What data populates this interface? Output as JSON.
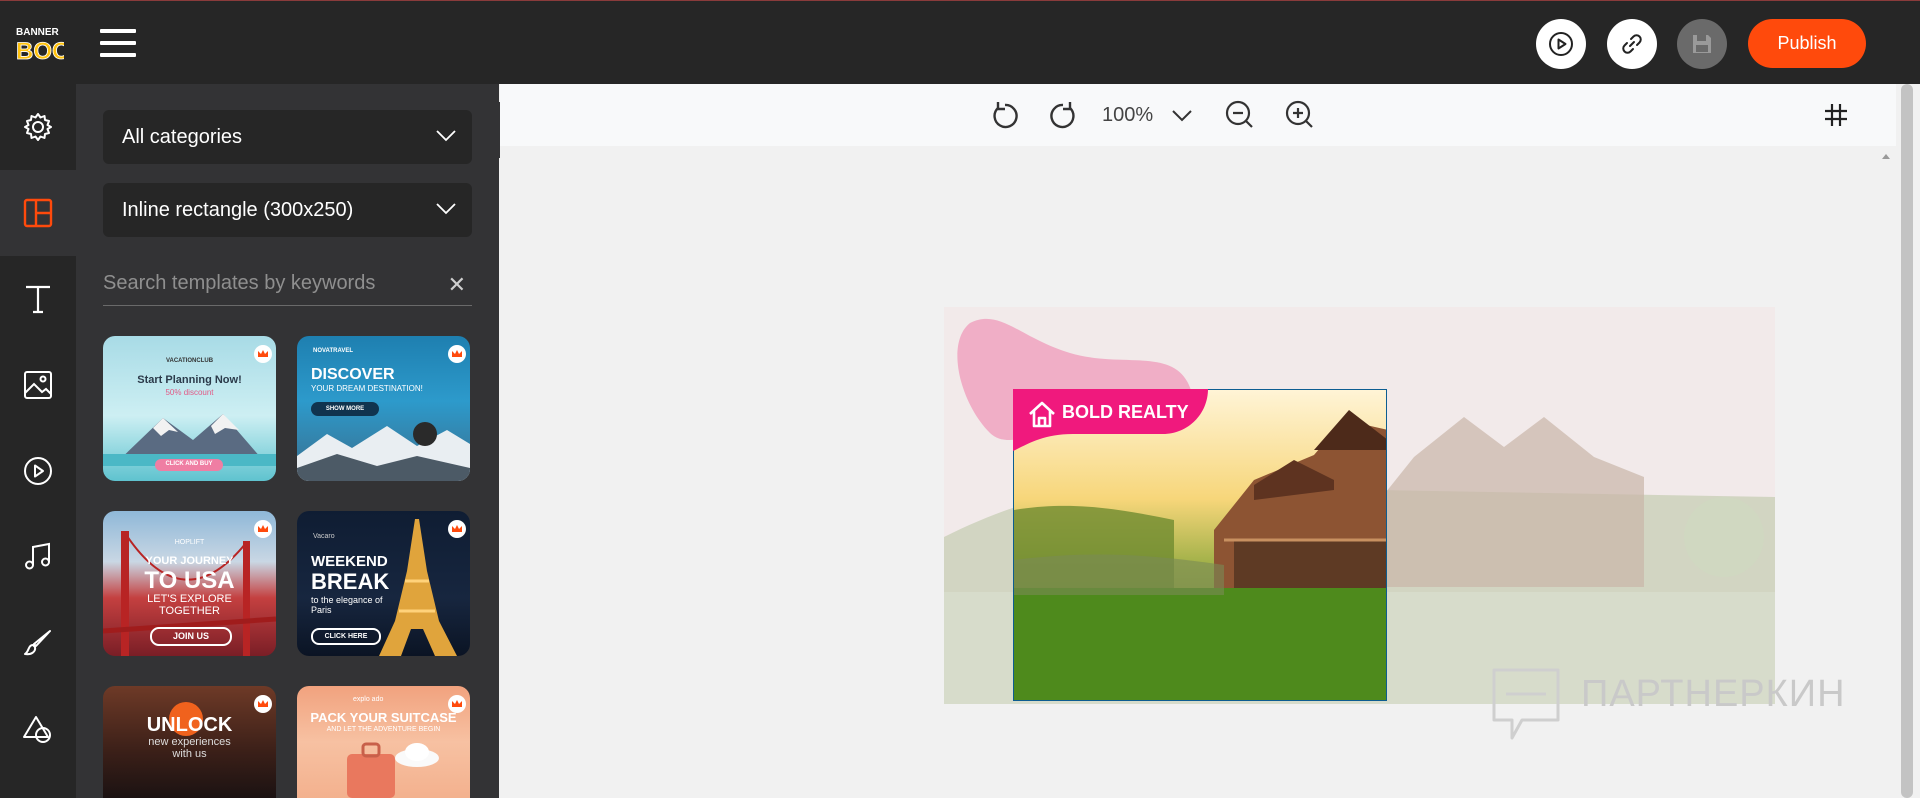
{
  "app": {
    "logo_line1": "BANNER",
    "logo_line2": "BOO"
  },
  "topbar": {
    "publish_label": "Publish"
  },
  "panel": {
    "category_value": "All categories",
    "size_value": "Inline rectangle (300x250)",
    "search_placeholder": "Search templates by keywords"
  },
  "templates": [
    {
      "brand": "VACATIONCLUB",
      "title": "Start Planning Now!",
      "subtitle": "50% discount",
      "cta": "CLICK AND BUY"
    },
    {
      "brand": "NOVATRAVEL",
      "title": "DISCOVER",
      "subtitle": "YOUR DREAM DESTINATION!",
      "cta": "SHOW MORE"
    },
    {
      "brand": "HOPLIFT",
      "title_small": "YOUR JOURNEY",
      "title": "TO USA",
      "subtitle": "LET'S EXPLORE TOGETHER",
      "cta": "JOIN US"
    },
    {
      "brand": "Vacaro",
      "title_small": "WEEKEND",
      "title": "BREAK",
      "subtitle": "to the elegance of Paris",
      "cta": "CLICK HERE"
    },
    {
      "title": "UNLOCK",
      "subtitle": "new experiences with us"
    },
    {
      "brand": "explo ado",
      "title": "PACK YOUR SUITCASE",
      "subtitle": "AND LET THE ADVENTURE BEGIN"
    }
  ],
  "toolbar": {
    "zoom": "100%"
  },
  "canvas": {
    "brand_text": "BOLD REALTY"
  },
  "watermark": "ПАРТНЕРКИН",
  "colors": {
    "accent": "#ff4a0c",
    "dark": "#262626",
    "panel": "#333335",
    "brand_pink": "#f0197d"
  }
}
